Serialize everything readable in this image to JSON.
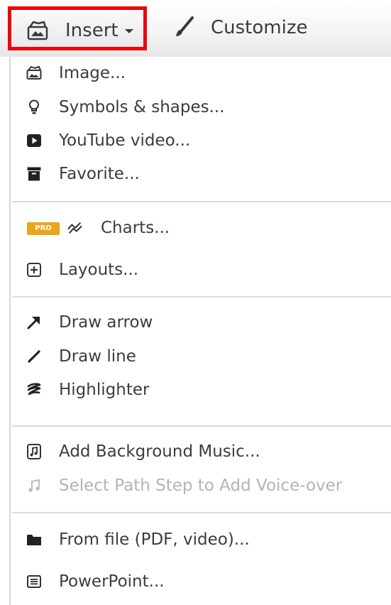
{
  "toolbar": {
    "insert_label": "Insert",
    "insert_icon": "insert-image-icon",
    "customize_label": "Customize",
    "customize_icon": "brush-icon",
    "highlight_color": "#e8060f"
  },
  "menu": {
    "groups": [
      {
        "items": [
          {
            "label": "Image...",
            "icon": "image-icon"
          },
          {
            "label": "Symbols & shapes...",
            "icon": "lightbulb-icon"
          },
          {
            "label": "YouTube video...",
            "icon": "youtube-icon"
          },
          {
            "label": "Favorite...",
            "icon": "archive-box-icon"
          }
        ]
      },
      {
        "items": [
          {
            "label": "Charts...",
            "icon": "chart-line-icon",
            "badge": "PRO"
          },
          {
            "label": "Layouts...",
            "icon": "plus-square-icon"
          }
        ]
      },
      {
        "items": [
          {
            "label": "Draw arrow",
            "icon": "arrow-icon"
          },
          {
            "label": "Draw line",
            "icon": "line-icon"
          },
          {
            "label": "Highlighter",
            "icon": "highlighter-icon"
          }
        ]
      },
      {
        "items": [
          {
            "label": "Add Background Music...",
            "icon": "music-file-icon"
          },
          {
            "label": "Select Path Step to Add Voice-over",
            "icon": "music-note-icon",
            "disabled": true
          }
        ]
      },
      {
        "items": [
          {
            "label": "From file (PDF, video)...",
            "icon": "folder-icon"
          },
          {
            "label": "PowerPoint...",
            "icon": "list-box-icon"
          }
        ]
      }
    ],
    "badge_color": "#eaa51c"
  }
}
